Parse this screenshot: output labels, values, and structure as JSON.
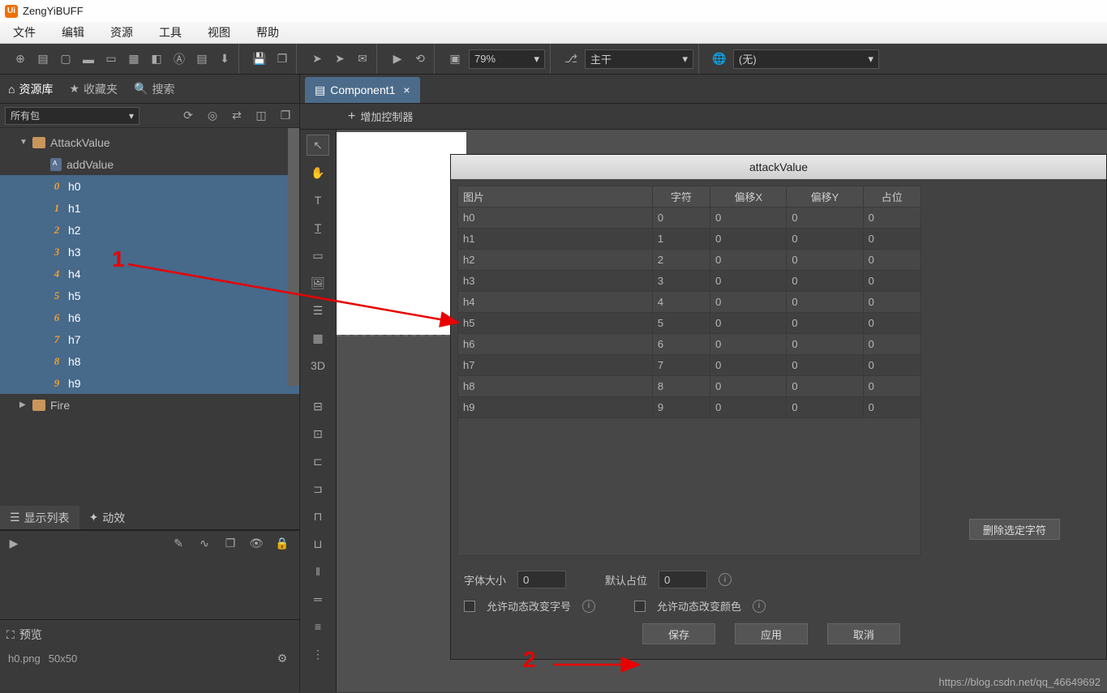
{
  "app": {
    "title": "ZengYiBUFF"
  },
  "menu": [
    "文件",
    "编辑",
    "资源",
    "工具",
    "视图",
    "帮助"
  ],
  "toolbar": {
    "zoom": "79%",
    "theme": "主干",
    "lang": "(无)"
  },
  "leftTabs": {
    "library": "资源库",
    "favorites": "收藏夹",
    "search": "搜索"
  },
  "packageSelect": "所有包",
  "tree": {
    "root": "AttackValue",
    "addValue": "addValue",
    "items": [
      "h0",
      "h1",
      "h2",
      "h3",
      "h4",
      "h5",
      "h6",
      "h7",
      "h8",
      "h9"
    ],
    "fire": "Fire"
  },
  "midTabs": {
    "displayList": "显示列表",
    "fx": "动效"
  },
  "previewLabel": "预览",
  "previewFile": "h0.png",
  "previewSize": "50x50",
  "docTab": "Component1",
  "addController": "增加控制器",
  "dialog": {
    "title": "attackValue",
    "headers": [
      "图片",
      "字符",
      "偏移X",
      "偏移Y",
      "占位"
    ],
    "rows": [
      [
        "h0",
        "0",
        "0",
        "0",
        "0"
      ],
      [
        "h1",
        "1",
        "0",
        "0",
        "0"
      ],
      [
        "h2",
        "2",
        "0",
        "0",
        "0"
      ],
      [
        "h3",
        "3",
        "0",
        "0",
        "0"
      ],
      [
        "h4",
        "4",
        "0",
        "0",
        "0"
      ],
      [
        "h5",
        "5",
        "0",
        "0",
        "0"
      ],
      [
        "h6",
        "6",
        "0",
        "0",
        "0"
      ],
      [
        "h7",
        "7",
        "0",
        "0",
        "0"
      ],
      [
        "h8",
        "8",
        "0",
        "0",
        "0"
      ],
      [
        "h9",
        "9",
        "0",
        "0",
        "0"
      ]
    ],
    "deleteChar": "删除选定字符",
    "fontSizeLabel": "字体大小",
    "fontSize": "0",
    "defaultSlotLabel": "默认占位",
    "defaultSlot": "0",
    "allowDynamicSize": "允许动态改变字号",
    "allowDynamicColor": "允许动态改变颜色",
    "save": "保存",
    "apply": "应用",
    "cancel": "取消"
  },
  "annot": {
    "one": "1",
    "two": "2"
  },
  "watermark": "https://blog.csdn.net/qq_46649692"
}
